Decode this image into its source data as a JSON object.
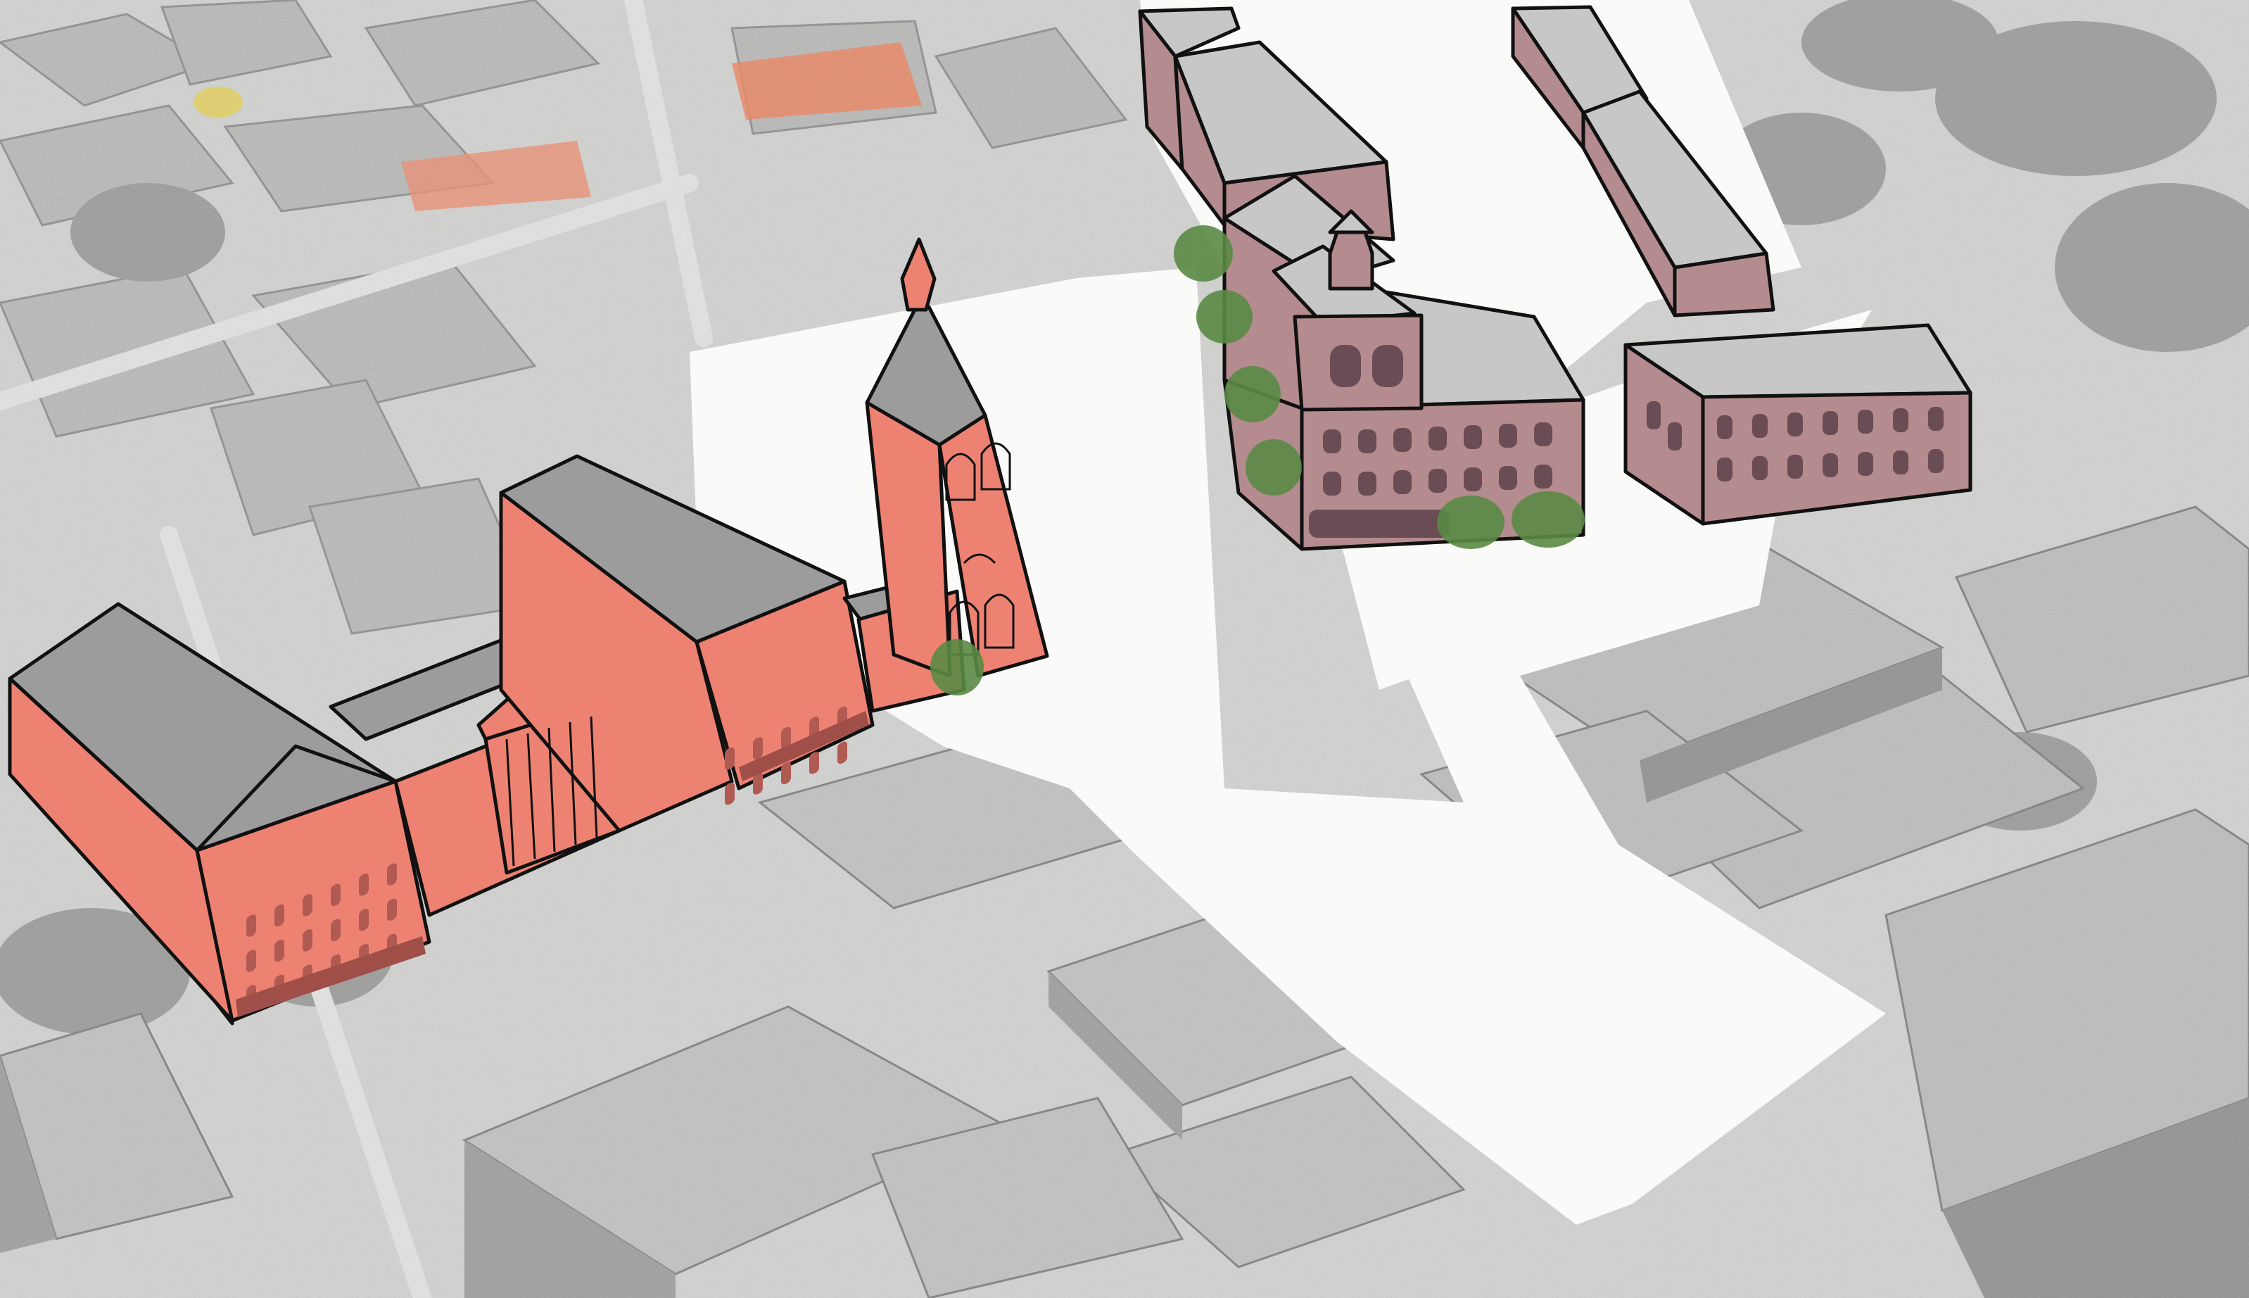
{
  "colors": {
    "paper": "#f7f7f5",
    "city_light": "#cfcfcd",
    "city_mid": "#a9a9a7",
    "city_dark": "#7d7d7b",
    "red_wall": "#ee8272",
    "red_wall_shade": "#d9685a",
    "mauve_wall": "#b48b8e",
    "mauve_wall_shade": "#9d7479",
    "roof_grey": "#9a9a9a",
    "window_red": "#a9544e",
    "window_mauve": "#6a4c55",
    "tree_green": "#5a8a45",
    "accent_orange": "#f0805a",
    "accent_yellow": "#e8d24a"
  },
  "layers": [
    {
      "name": "aerial-photo-background",
      "kind": "greyscale aerial city photograph"
    },
    {
      "name": "planning-area",
      "kind": "blank white zone"
    },
    {
      "name": "red-building-complex",
      "kind": "hand-coloured sketch model"
    },
    {
      "name": "mauve-building-blocks",
      "kind": "hand-coloured sketch model"
    },
    {
      "name": "street-trees",
      "kind": "green scribbled trees"
    }
  ]
}
